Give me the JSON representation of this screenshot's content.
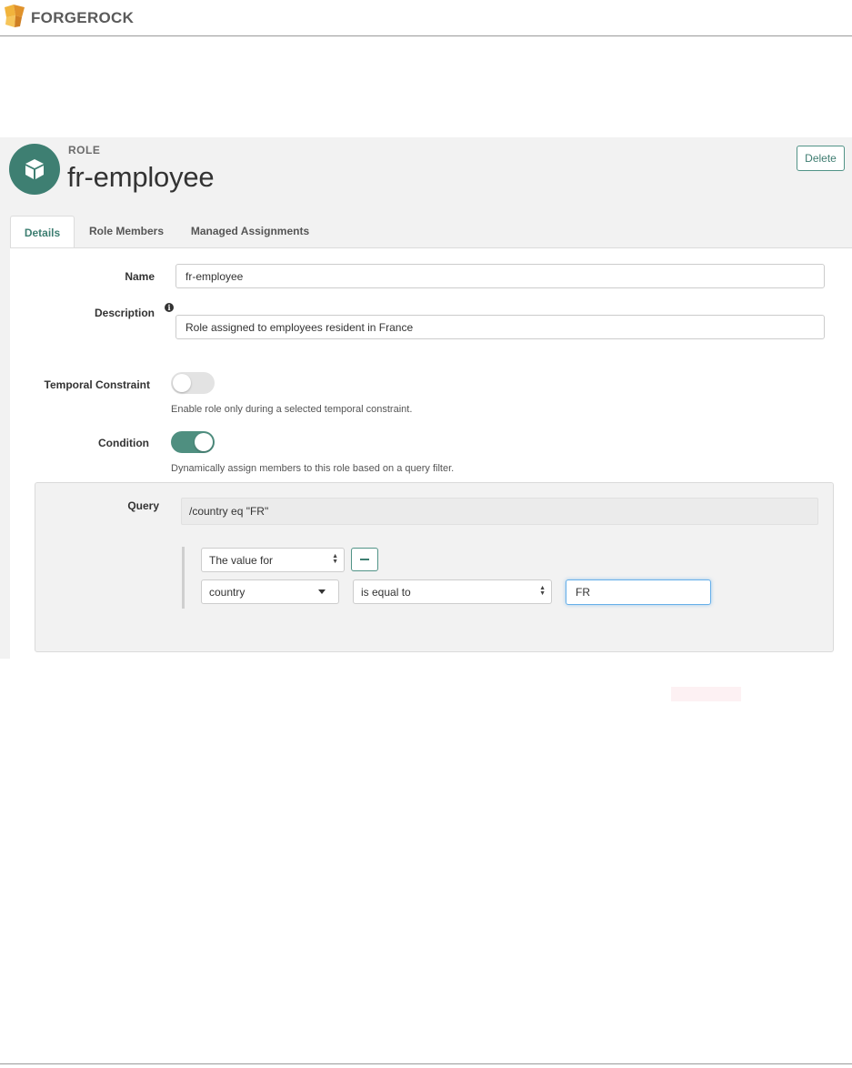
{
  "app": {
    "brand_name": "FORGEROCK",
    "logo_icon": "forgerock-logo-icon",
    "accent_color": "#3e7f72"
  },
  "role": {
    "kicker": "ROLE",
    "title": "fr-employee",
    "icon": "cube-icon",
    "delete_label": "Delete"
  },
  "tabs": [
    {
      "label": "Details",
      "active": true
    },
    {
      "label": "Role Members",
      "active": false
    },
    {
      "label": "Managed Assignments",
      "active": false
    }
  ],
  "form": {
    "name_label": "Name",
    "name_value": "fr-employee",
    "description_label": "Description",
    "description_info_icon": "info-icon",
    "description_value": "Role assigned to employees resident in France",
    "temporal_label": "Temporal Constraint",
    "temporal_enabled": false,
    "temporal_help": "Enable role only during a selected temporal constraint.",
    "condition_label": "Condition",
    "condition_enabled": true,
    "condition_help": "Dynamically assign members to this role based on a query filter."
  },
  "query": {
    "label": "Query",
    "value": "/country eq \"FR\"",
    "rule_type": "The value for",
    "remove_icon": "minus-icon",
    "field": "country",
    "operator": "is equal to",
    "compare_value": "FR"
  }
}
